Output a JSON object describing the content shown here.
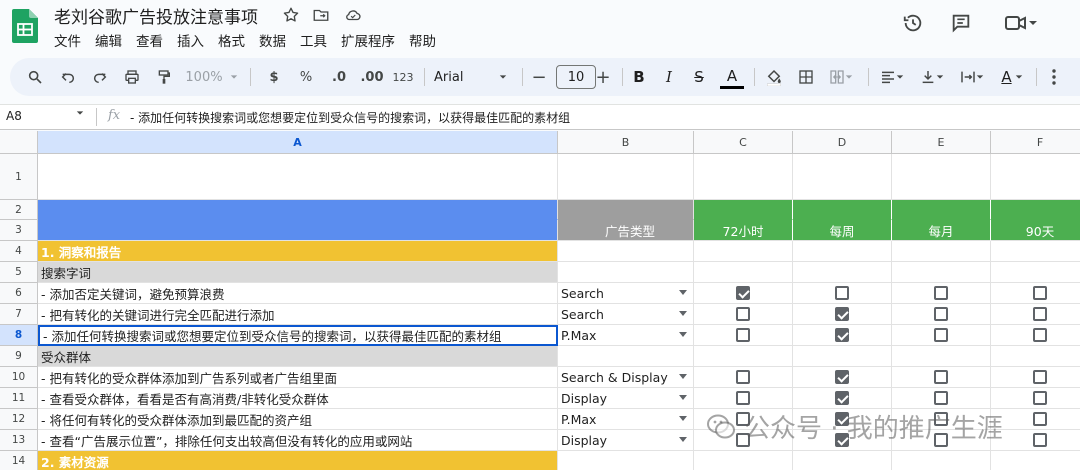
{
  "app": {
    "doc_title": "老刘谷歌广告投放注意事项",
    "menu": [
      "文件",
      "编辑",
      "查看",
      "插入",
      "格式",
      "数据",
      "工具",
      "扩展程序",
      "帮助"
    ]
  },
  "icons": {
    "title_icons": [
      "star-icon",
      "move-to-folder-icon",
      "cloud-status-icon"
    ],
    "right_icons": [
      "history-icon",
      "comment-icon",
      "meet-icon"
    ]
  },
  "toolbar": {
    "zoom": "100%",
    "currency": "$",
    "percent": "%",
    "decrease_decimal": ".0",
    "increase_decimal": ".00",
    "number_format": "123",
    "font": "Arial",
    "font_size": "10",
    "minus": "−",
    "plus": "+",
    "bold": "B",
    "italic": "I",
    "strike": "S",
    "text_color": "A",
    "text_rotation": "A"
  },
  "formula_bar": {
    "name_box": "A8",
    "fx": "fx",
    "content": "- 添加任何转换搜索词或您想要定位到受众信号的搜索词，以获得最佳匹配的素材组"
  },
  "columns": [
    "A",
    "B",
    "C",
    "D",
    "E",
    "F"
  ],
  "rows": [
    {
      "num": "1"
    },
    {
      "num": "2"
    },
    {
      "num": "3",
      "b": "广告类型",
      "c": "72小时",
      "d": "每周",
      "e": "每月",
      "f": "90天"
    },
    {
      "num": "4",
      "a": "1. 洞察和报告"
    },
    {
      "num": "5",
      "a": "搜索字词"
    },
    {
      "num": "6",
      "a": "- 添加否定关键词，避免预算浪费",
      "b": "Search",
      "checks": [
        true,
        false,
        false,
        false
      ]
    },
    {
      "num": "7",
      "a": "- 把有转化的关键词进行完全匹配进行添加",
      "b": "Search",
      "checks": [
        false,
        true,
        false,
        false
      ]
    },
    {
      "num": "8",
      "a": "- 添加任何转换搜索词或您想要定位到受众信号的搜索词，以获得最佳匹配的素材组",
      "b": "P.Max",
      "checks": [
        false,
        true,
        false,
        false
      ]
    },
    {
      "num": "9",
      "a": "受众群体"
    },
    {
      "num": "10",
      "a": "- 把有转化的受众群体添加到广告系列或者广告组里面",
      "b": "Search & Display",
      "checks": [
        false,
        true,
        false,
        false
      ]
    },
    {
      "num": "11",
      "a": "- 查看受众群体，看看是否有高消费/非转化受众群体",
      "b": "Display",
      "checks": [
        false,
        true,
        false,
        false
      ]
    },
    {
      "num": "12",
      "a": "- 将任何有转化的受众群体添加到最匹配的资产组",
      "b": "P.Max",
      "checks": [
        false,
        true,
        false,
        false
      ]
    },
    {
      "num": "13",
      "a": "- 查看“广告展示位置”，排除任何支出较高但没有转化的应用或网站",
      "b": "Display",
      "checks": [
        false,
        true,
        false,
        false
      ]
    },
    {
      "num": "14",
      "a": "2. 素材资源"
    }
  ],
  "watermark": "公众号 · 我的推广生涯",
  "colors": {
    "blue_header": "#5b8def",
    "gray_header": "#9e9e9e",
    "green_header": "#4caf50",
    "section_yellow": "#f1c232",
    "subsection_gray": "#d9d9d9",
    "selection_blue": "#0b57d0"
  }
}
